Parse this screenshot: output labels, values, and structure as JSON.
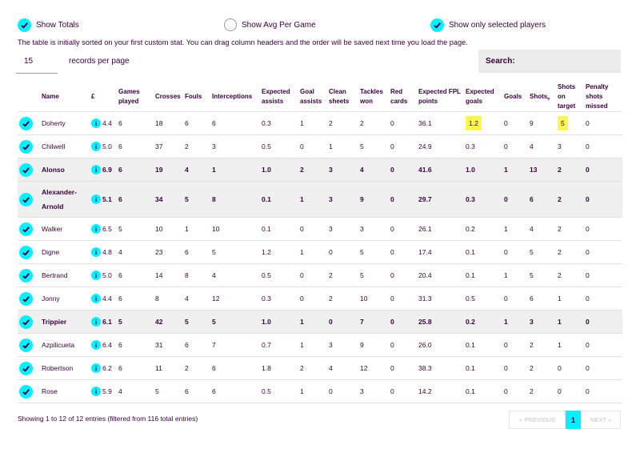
{
  "toggles": {
    "show_totals": "Show Totals",
    "show_avg": "Show Avg Per Game",
    "show_selected": "Show only selected players"
  },
  "intro": "The table is initially sorted on your first custom stat. You can drag column headers and the order will be saved next time you load the page.",
  "length": {
    "value": "15",
    "label": "records per page"
  },
  "search": {
    "label": "Search:",
    "value": ""
  },
  "columns": [
    "Name",
    "£",
    "Games played",
    "Crosses",
    "Fouls",
    "Interceptions",
    "Expected assists",
    "Goal assists",
    "Clean sheets",
    "Tackles won",
    "Red cards",
    "Expected FPL points",
    "Expected goals",
    "Goals",
    "Shots",
    "Shots on target",
    "Penalty shots missed"
  ],
  "info_symbol": "i",
  "rows": [
    {
      "name": "Doherty",
      "price": "4.4",
      "games": "6",
      "crosses": "18",
      "fouls": "6",
      "interceptions": "6",
      "xa": "0.3",
      "assists": "1",
      "cs": "2",
      "tackles": "2",
      "red": "0",
      "xfpl": "36.1",
      "xg": "1.2",
      "goals": "0",
      "shots": "9",
      "sot": "5",
      "pen": "0"
    },
    {
      "name": "Chilwell",
      "price": "5.0",
      "games": "6",
      "crosses": "37",
      "fouls": "2",
      "interceptions": "3",
      "xa": "0.5",
      "assists": "0",
      "cs": "1",
      "tackles": "5",
      "red": "0",
      "xfpl": "24.9",
      "xg": "0.3",
      "goals": "0",
      "shots": "4",
      "sot": "3",
      "pen": "0"
    },
    {
      "name": "Alonso",
      "price": "6.9",
      "games": "6",
      "crosses": "19",
      "fouls": "4",
      "interceptions": "1",
      "xa": "1.0",
      "assists": "2",
      "cs": "3",
      "tackles": "4",
      "red": "0",
      "xfpl": "41.6",
      "xg": "1.0",
      "goals": "1",
      "shots": "13",
      "sot": "2",
      "pen": "0"
    },
    {
      "name": "Alexander-Arnold",
      "price": "5.1",
      "games": "6",
      "crosses": "34",
      "fouls": "5",
      "interceptions": "8",
      "xa": "0.1",
      "assists": "1",
      "cs": "3",
      "tackles": "9",
      "red": "0",
      "xfpl": "29.7",
      "xg": "0.3",
      "goals": "0",
      "shots": "6",
      "sot": "2",
      "pen": "0"
    },
    {
      "name": "Walker",
      "price": "6.5",
      "games": "5",
      "crosses": "10",
      "fouls": "1",
      "interceptions": "10",
      "xa": "0.1",
      "assists": "0",
      "cs": "3",
      "tackles": "3",
      "red": "0",
      "xfpl": "26.1",
      "xg": "0.2",
      "goals": "1",
      "shots": "4",
      "sot": "2",
      "pen": "0"
    },
    {
      "name": "Digne",
      "price": "4.8",
      "games": "4",
      "crosses": "23",
      "fouls": "6",
      "interceptions": "5",
      "xa": "1.2",
      "assists": "1",
      "cs": "0",
      "tackles": "5",
      "red": "0",
      "xfpl": "17.4",
      "xg": "0.1",
      "goals": "0",
      "shots": "5",
      "sot": "2",
      "pen": "0"
    },
    {
      "name": "Bertrand",
      "price": "5.0",
      "games": "6",
      "crosses": "14",
      "fouls": "8",
      "interceptions": "4",
      "xa": "0.5",
      "assists": "0",
      "cs": "2",
      "tackles": "5",
      "red": "0",
      "xfpl": "20.4",
      "xg": "0.1",
      "goals": "1",
      "shots": "5",
      "sot": "2",
      "pen": "0"
    },
    {
      "name": "Jonny",
      "price": "4.4",
      "games": "6",
      "crosses": "8",
      "fouls": "4",
      "interceptions": "12",
      "xa": "0.3",
      "assists": "0",
      "cs": "2",
      "tackles": "10",
      "red": "0",
      "xfpl": "31.3",
      "xg": "0.5",
      "goals": "0",
      "shots": "6",
      "sot": "1",
      "pen": "0"
    },
    {
      "name": "Trippier",
      "price": "6.1",
      "games": "5",
      "crosses": "42",
      "fouls": "5",
      "interceptions": "5",
      "xa": "1.0",
      "assists": "1",
      "cs": "0",
      "tackles": "7",
      "red": "0",
      "xfpl": "25.8",
      "xg": "0.2",
      "goals": "1",
      "shots": "3",
      "sot": "1",
      "pen": "0"
    },
    {
      "name": "Azpilicueta",
      "price": "6.4",
      "games": "6",
      "crosses": "31",
      "fouls": "6",
      "interceptions": "7",
      "xa": "0.7",
      "assists": "1",
      "cs": "3",
      "tackles": "9",
      "red": "0",
      "xfpl": "26.0",
      "xg": "0.1",
      "goals": "0",
      "shots": "2",
      "sot": "1",
      "pen": "0"
    },
    {
      "name": "Robertson",
      "price": "6.2",
      "games": "6",
      "crosses": "11",
      "fouls": "2",
      "interceptions": "6",
      "xa": "1.8",
      "assists": "2",
      "cs": "4",
      "tackles": "12",
      "red": "0",
      "xfpl": "38.3",
      "xg": "0.1",
      "goals": "0",
      "shots": "2",
      "sot": "0",
      "pen": "0"
    },
    {
      "name": "Rose",
      "price": "5.9",
      "games": "4",
      "crosses": "5",
      "fouls": "6",
      "interceptions": "6",
      "xa": "0.5",
      "assists": "1",
      "cs": "0",
      "tackles": "3",
      "red": "0",
      "xfpl": "14.2",
      "xg": "0.1",
      "goals": "0",
      "shots": "2",
      "sot": "0",
      "pen": "0"
    }
  ],
  "footer": {
    "info": "Showing 1 to 12 of 12 entries (filtered from 116 total entries)",
    "prev": "« PREVIOUS",
    "page": "1",
    "next": "NEXT »"
  },
  "colors": {
    "accent": "#05f0ff",
    "highlight": "#fbf84d",
    "text": "#37003c"
  }
}
